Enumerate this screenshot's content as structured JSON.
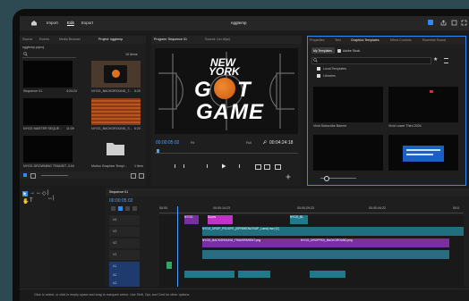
{
  "app": {
    "title": "nggtemp"
  },
  "menu": {
    "import": "Import",
    "edit": "Edit",
    "export": "Export"
  },
  "project_panel": {
    "tabs": [
      "Source",
      "Events",
      "Media Browser",
      "Project: nggtemp"
    ],
    "active_tab": "Project: nggtemp",
    "file": "nggtemp.prproj",
    "item_count": "15 items",
    "items": [
      {
        "name": "Sequence 01",
        "duration": "4:24:24"
      },
      {
        "name": "NYGG_BACKGROUND_T...",
        "duration": "6:20"
      },
      {
        "name": "NYGG MASTER SEQUE...",
        "duration": "11:09"
      },
      {
        "name": "NYGG_BACKGROUND_S...",
        "duration": "6:20"
      },
      {
        "name": "NYGG DROWNING TRANSIT...",
        "duration": "3:04"
      },
      {
        "name": "Motion Graphics Templ...",
        "duration": "1 Item"
      }
    ]
  },
  "program_monitor": {
    "tabs": [
      "Program: Sequence 01",
      "Source: (no clips)"
    ],
    "title_lines": [
      "NEW",
      "YORK",
      "G",
      "T",
      "GAME"
    ],
    "timecode": "00:00:05:02",
    "zoom": "Fit",
    "quality": "Full",
    "duration": "00:04:24:18"
  },
  "essential_graphics": {
    "tabs": [
      "Properties",
      "Text",
      "Graphics Templates",
      "Effect Controls",
      "Essential Sound"
    ],
    "subtabs": [
      "My Templates",
      "Adobe Stock"
    ],
    "local_templates": "Local Templates",
    "libraries": "Libraries",
    "templates": [
      {
        "name": "Vivid Subscribe Banner"
      },
      {
        "name": "Vivid Lower Third 2024"
      },
      {
        "name": ""
      },
      {
        "name": ""
      }
    ]
  },
  "timeline": {
    "tab": "Sequence 01",
    "timecode": "00:00:05:02",
    "ruler": [
      "00:00",
      "00:00:14:23",
      "00:00:29:23",
      "00:00:44:22",
      "00:0"
    ],
    "tracks": [
      "V4",
      "V3",
      "V2",
      "V1",
      "A1",
      "A2",
      "A3"
    ],
    "clips": {
      "v4_a": "NYGG",
      "v4_b": "Drows",
      "v4_c": "NYGG_BL",
      "v3": "NYGG_DROP_PSOOFE_[SPRBROW-RIUP_Luma] mov [V]",
      "v2_a": "NYGG_BACKGROUND_TRANSPARENT.png",
      "v2_b": "NYGG_DROPPED_BACKGROUND.png"
    }
  },
  "status_bar": "Click to select, or click in empty space and drag to marquee select. Use Shift, Opt, and Cmd for other options.",
  "colors": {
    "accent": "#2f8af5",
    "clip_teal": "#1f7a8c",
    "clip_purple": "#7a2fa0",
    "clip_magenta": "#c232c8",
    "clip_green": "#2ba866",
    "playhead": "#4ea3ff"
  }
}
